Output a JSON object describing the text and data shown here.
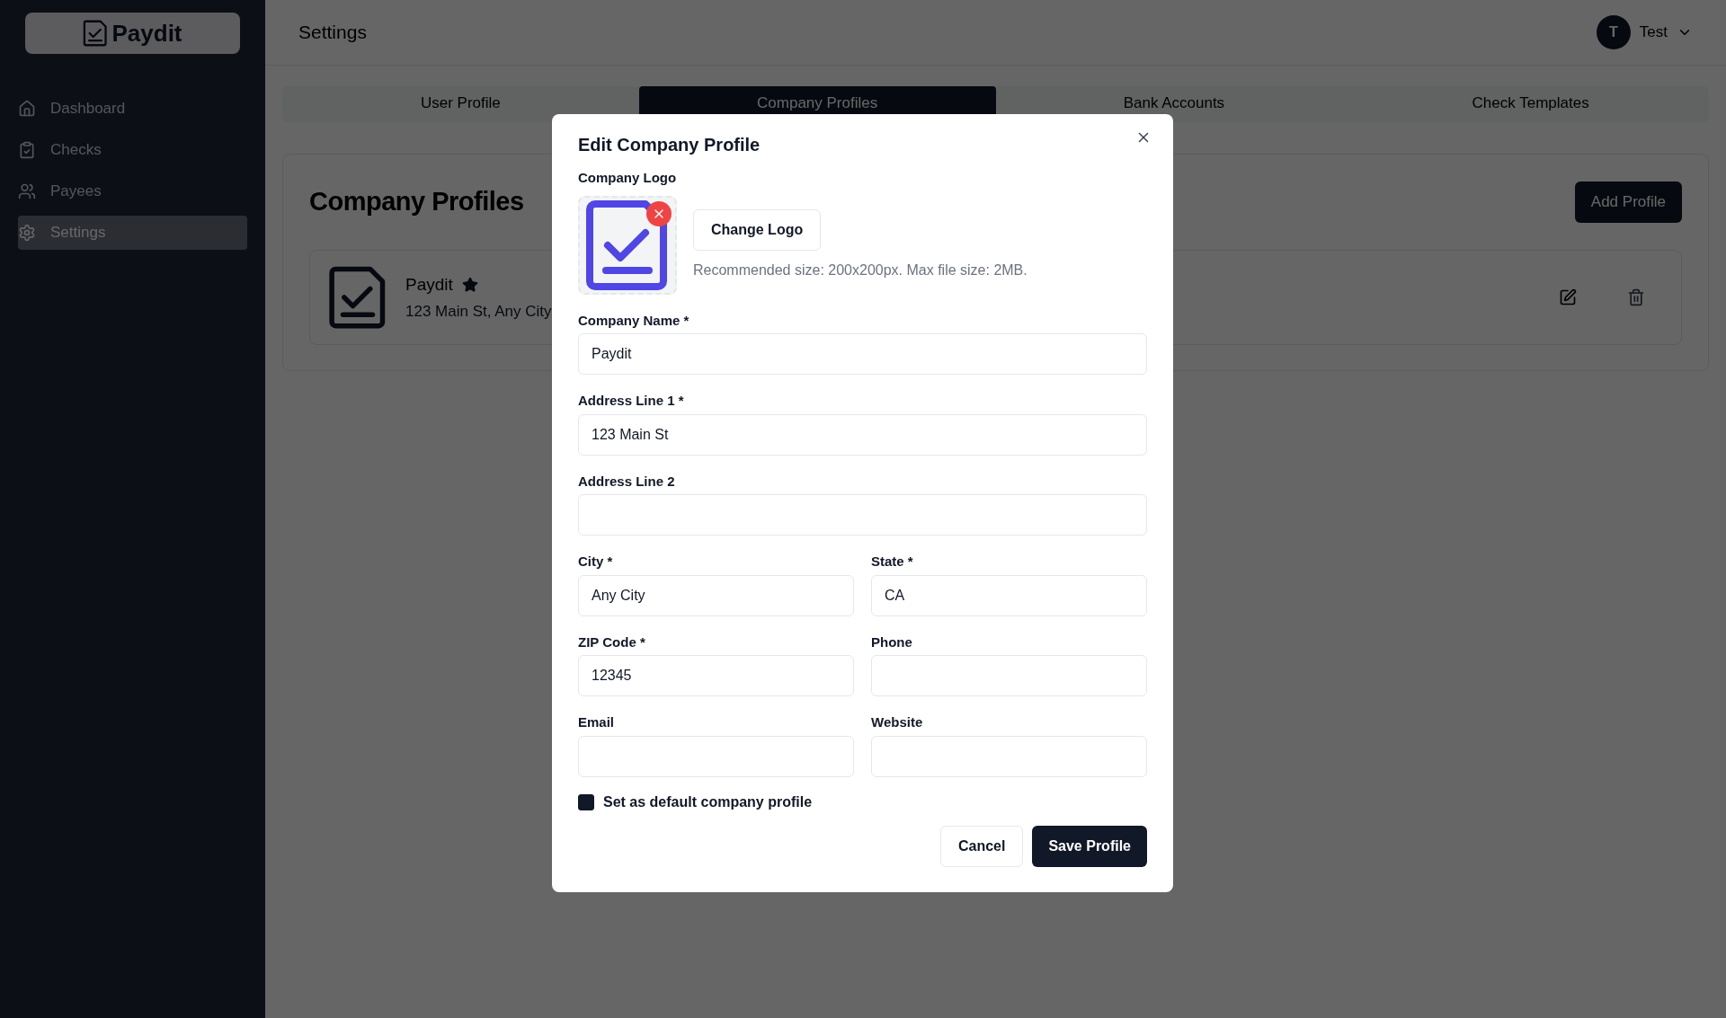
{
  "sidebar": {
    "logo": "Paydit",
    "items": [
      {
        "label": "Dashboard",
        "kind": "home",
        "selected": false
      },
      {
        "label": "Checks",
        "kind": "checks",
        "selected": false
      },
      {
        "label": "Payees",
        "kind": "payees",
        "selected": false
      },
      {
        "label": "Settings",
        "kind": "settings",
        "selected": true
      }
    ]
  },
  "header": {
    "title": "Settings",
    "user": {
      "initial": "T",
      "name": "Test"
    }
  },
  "tabs": [
    {
      "label": "User Profile",
      "selected": false
    },
    {
      "label": "Company Profiles",
      "selected": true
    },
    {
      "label": "Bank Accounts",
      "selected": false
    },
    {
      "label": "Check Templates",
      "selected": false
    }
  ],
  "profiles_panel": {
    "title": "Company Profiles",
    "add_button": "Add Profile",
    "profiles": [
      {
        "name": "Paydit",
        "default": true,
        "address": "123 Main St, Any City,"
      }
    ]
  },
  "dialog": {
    "title": "Edit Company Profile",
    "logo_label": "Company Logo",
    "change_logo": "Change Logo",
    "logo_hint": "Recommended size: 200x200px. Max file size: 2MB.",
    "fields": [
      {
        "label": "Company Name *",
        "value": "Paydit",
        "full_width": true
      },
      {
        "label": "Address Line 1 *",
        "value": "123 Main St",
        "full_width": true
      },
      {
        "label": "Address Line 2",
        "full_width": true
      },
      {
        "label": "City *",
        "value": "Any City",
        "full_width": false
      },
      {
        "label": "State *",
        "value": "CA",
        "full_width": false
      },
      {
        "label": "ZIP Code *",
        "value": "12345",
        "full_width": false
      },
      {
        "label": "Phone",
        "full_width": false
      },
      {
        "label": "Email",
        "full_width": false
      },
      {
        "label": "Website",
        "full_width": false
      }
    ],
    "default_checkbox": {
      "label": "Set as default company profile",
      "checked": true
    },
    "buttons": {
      "cancel": "Cancel",
      "save": "Save Profile"
    }
  }
}
